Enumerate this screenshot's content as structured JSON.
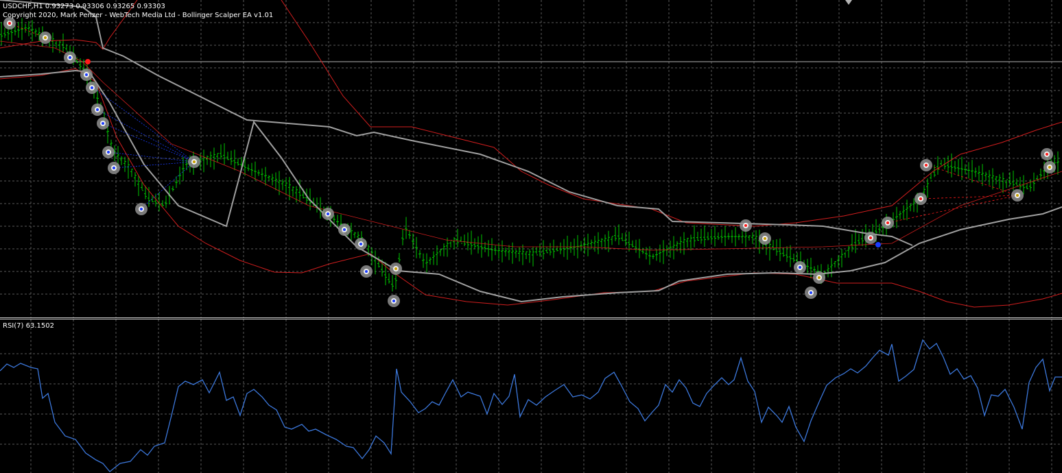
{
  "main_chart": {
    "symbol_line": "USDCHF,H1  0.93273 0.93306 0.93265 0.93303",
    "copyright_line": "Copyright 2020, Mark Penzer - WebTech Media Ltd - Bollinger Scalper EA  v1.01"
  },
  "rsi_panel": {
    "title": "RSI(7) 63.1502"
  },
  "colors": {
    "background": "#000000",
    "grid": "#5a5a5a",
    "bars": "#00c800",
    "bollinger_outer": "#d21e1e",
    "bollinger_mid": "#a0a0a0",
    "rsi_line": "#3c78dc",
    "signal_blue": "#1a3cff",
    "signal_red": "#ff1a1a",
    "marker_ring": "#8f8f8f"
  },
  "icons": [
    "buy-signal-icon",
    "sell-signal-icon",
    "exit-signal-icon"
  ]
}
